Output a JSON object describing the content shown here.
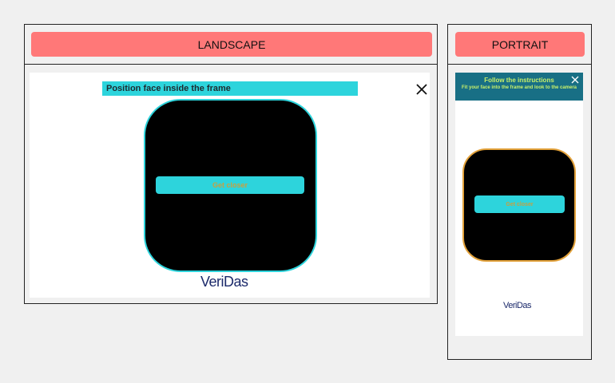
{
  "landscape": {
    "tab_label": "LANDSCAPE",
    "instruction": "Position face inside the frame",
    "close_icon": "close-icon",
    "status_label": "Get closer",
    "logo": "VeriDas"
  },
  "portrait": {
    "tab_label": "PORTRAIT",
    "banner_title": "Follow the instructions",
    "banner_text": "Fit your face into the frame and look to the camera",
    "close_icon": "close-icon",
    "status_label": "Get closer",
    "logo": "VeriDas"
  },
  "colors": {
    "tab_background": "#ff7878",
    "accent_cyan": "#2dd4dc",
    "landscape_frame_border": "#2dd4dc",
    "portrait_frame_border": "#e2a13a",
    "banner_background": "#186f85",
    "banner_text": "#c8f06a",
    "logo": "#1c2a6b"
  }
}
